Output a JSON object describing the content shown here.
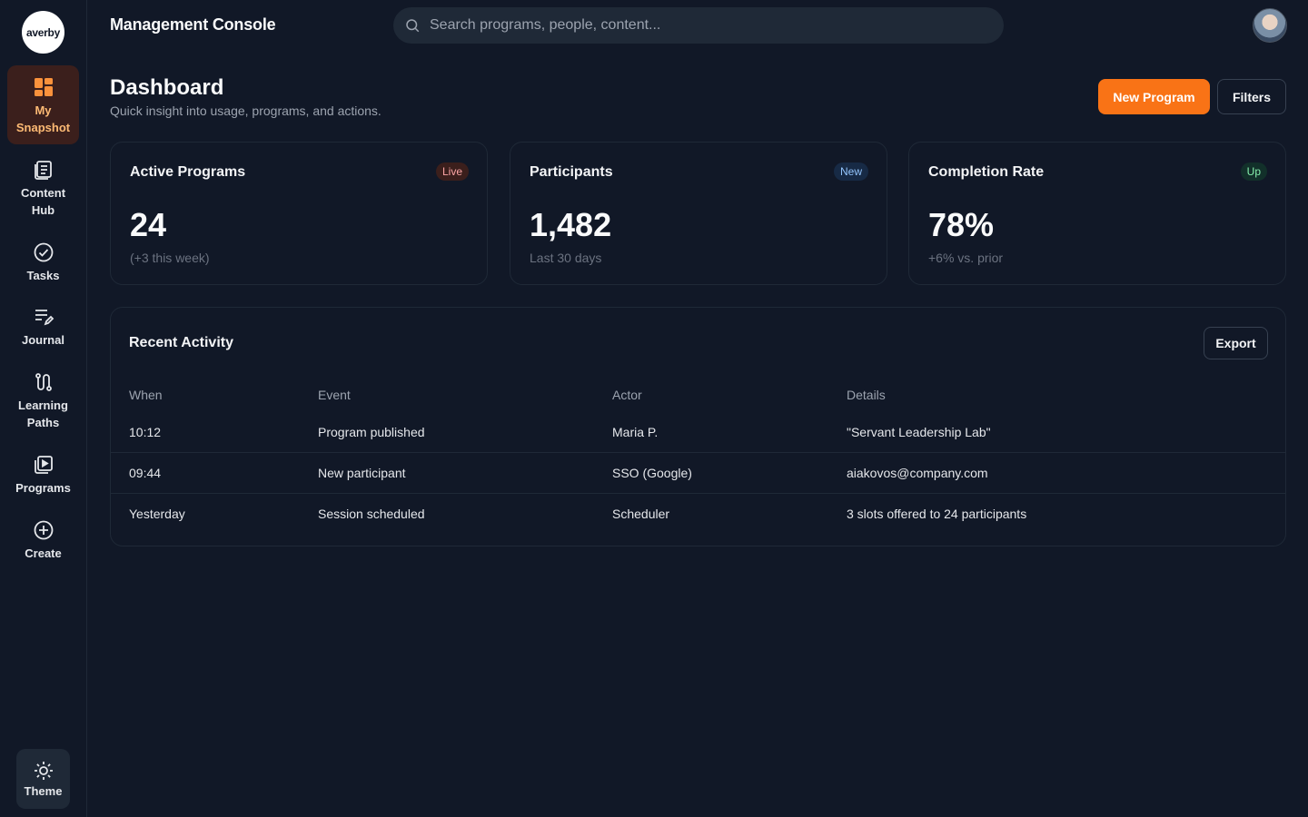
{
  "logo": {
    "text": "averby"
  },
  "sidebar": {
    "items": [
      {
        "label": "My\nSnapshot",
        "icon": "grid-icon",
        "active": true
      },
      {
        "label": "Content\nHub",
        "icon": "document-icon"
      },
      {
        "label": "Tasks",
        "icon": "check-circle-icon"
      },
      {
        "label": "Journal",
        "icon": "edit-lines-icon"
      },
      {
        "label": "Learning\nPaths",
        "icon": "path-icon"
      },
      {
        "label": "Programs",
        "icon": "play-stack-icon"
      },
      {
        "label": "Create",
        "icon": "plus-circle-icon"
      }
    ],
    "theme_label": "Theme"
  },
  "topbar": {
    "title": "Management Console",
    "search_placeholder": "Search programs, people, content..."
  },
  "header": {
    "title": "Dashboard",
    "subtitle": "Quick insight into usage, programs, and actions.",
    "new_program_label": "New Program",
    "filters_label": "Filters"
  },
  "stats": [
    {
      "title": "Active Programs",
      "badge": "Live",
      "value": "24",
      "sub": "(+3 this week)",
      "badge_bg": "#3b1f1c",
      "badge_fg": "#fca5a5"
    },
    {
      "title": "Participants",
      "badge": "New",
      "value": "1,482",
      "sub": "Last 30 days",
      "badge_bg": "#172a45",
      "badge_fg": "#93c5fd"
    },
    {
      "title": "Completion Rate",
      "badge": "Up",
      "value": "78%",
      "sub": "+6% vs. prior",
      "badge_bg": "#12302a",
      "badge_fg": "#86efac"
    }
  ],
  "activity": {
    "title": "Recent Activity",
    "export_label": "Export",
    "columns": [
      "When",
      "Event",
      "Actor",
      "Details"
    ],
    "rows": [
      [
        "10:12",
        "Program published",
        "Maria P.",
        "\"Servant Leadership Lab\""
      ],
      [
        "09:44",
        "New participant",
        "SSO (Google)",
        "aiakovos@company.com"
      ],
      [
        "Yesterday",
        "Session scheduled",
        "Scheduler",
        "3 slots offered to 24 participants"
      ]
    ]
  },
  "colors": {
    "accent": "#f97316",
    "background": "#111827",
    "surface": "#1f2937"
  }
}
